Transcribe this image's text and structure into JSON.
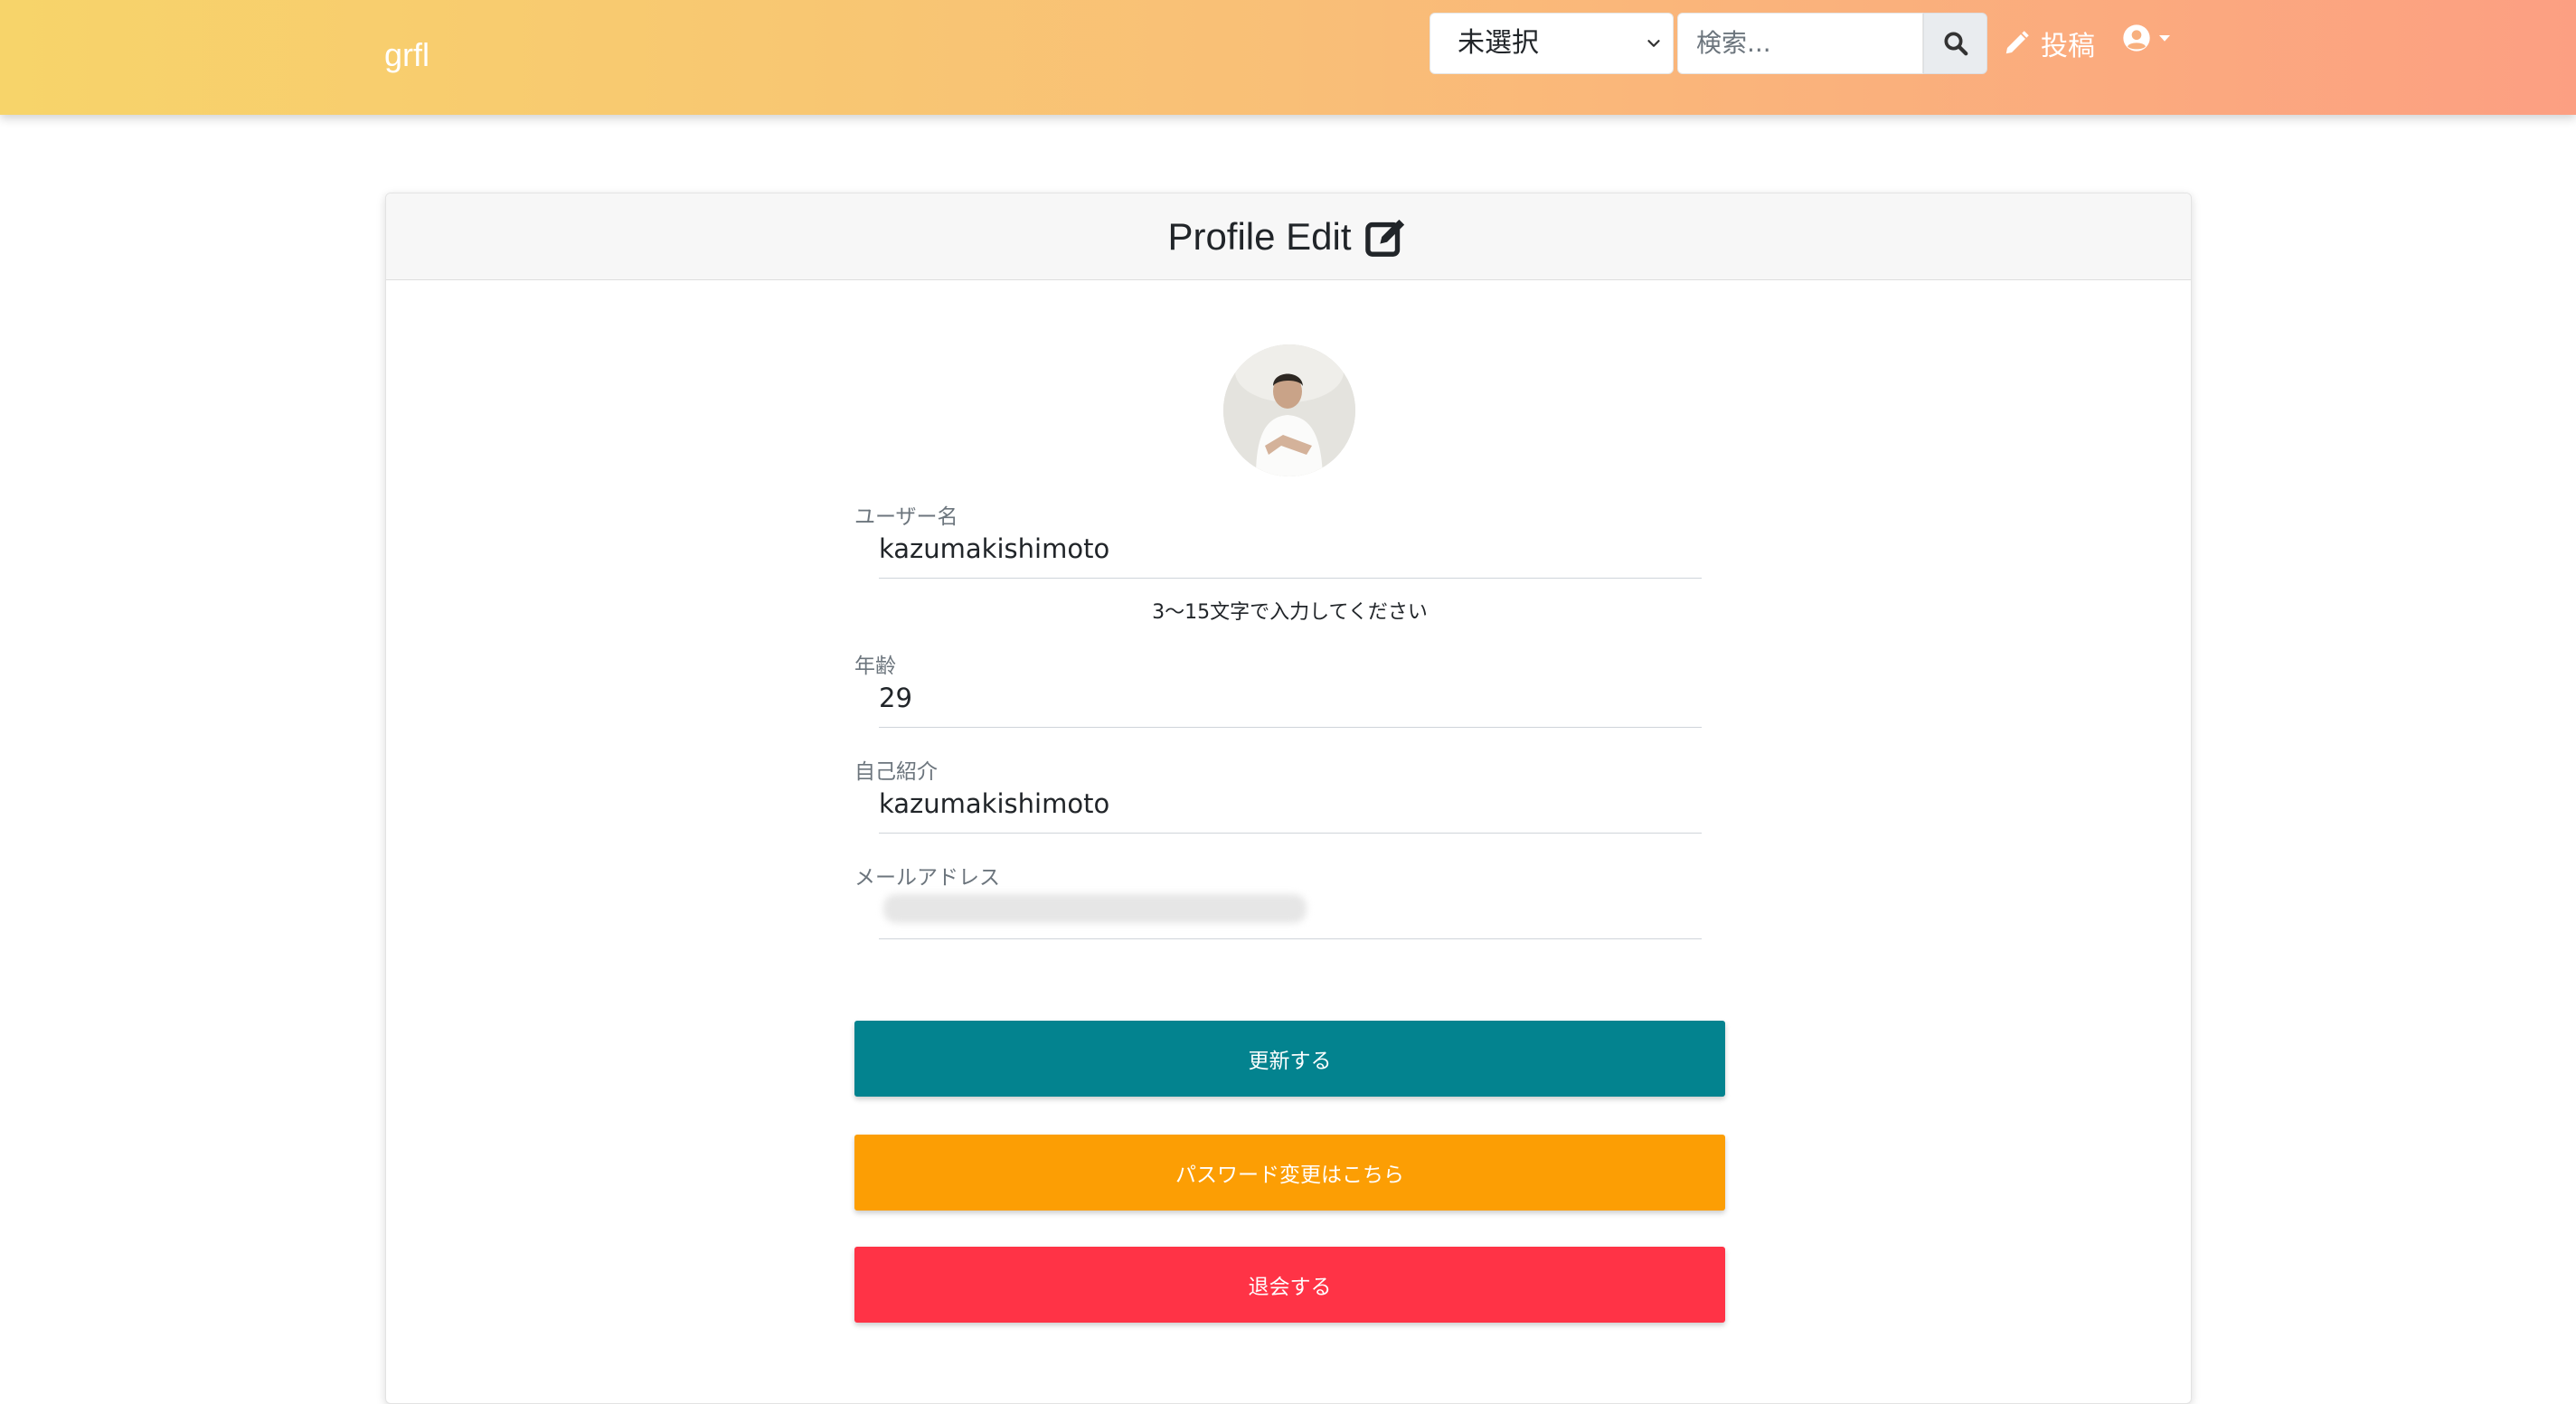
{
  "navbar": {
    "brand": "grfl",
    "category_select": "未選択",
    "search_placeholder": "検索...",
    "post_label": "投稿"
  },
  "card": {
    "title": "Profile Edit"
  },
  "form": {
    "username": {
      "label": "ユーザー名",
      "value": "kazumakishimoto",
      "helper": "3〜15文字で入力してください"
    },
    "age": {
      "label": "年齢",
      "value": "29"
    },
    "bio": {
      "label": "自己紹介",
      "value": "kazumakishimoto"
    },
    "email": {
      "label": "メールアドレス"
    }
  },
  "buttons": {
    "update": "更新する",
    "password": "パスワード変更はこちら",
    "withdraw": "退会する"
  },
  "colors": {
    "navbar_gradient_start": "#f7d46a",
    "navbar_gradient_end": "#fc9f82",
    "update_button": "#03838f",
    "password_button": "#fc9e04",
    "withdraw_button": "#ff3346"
  }
}
